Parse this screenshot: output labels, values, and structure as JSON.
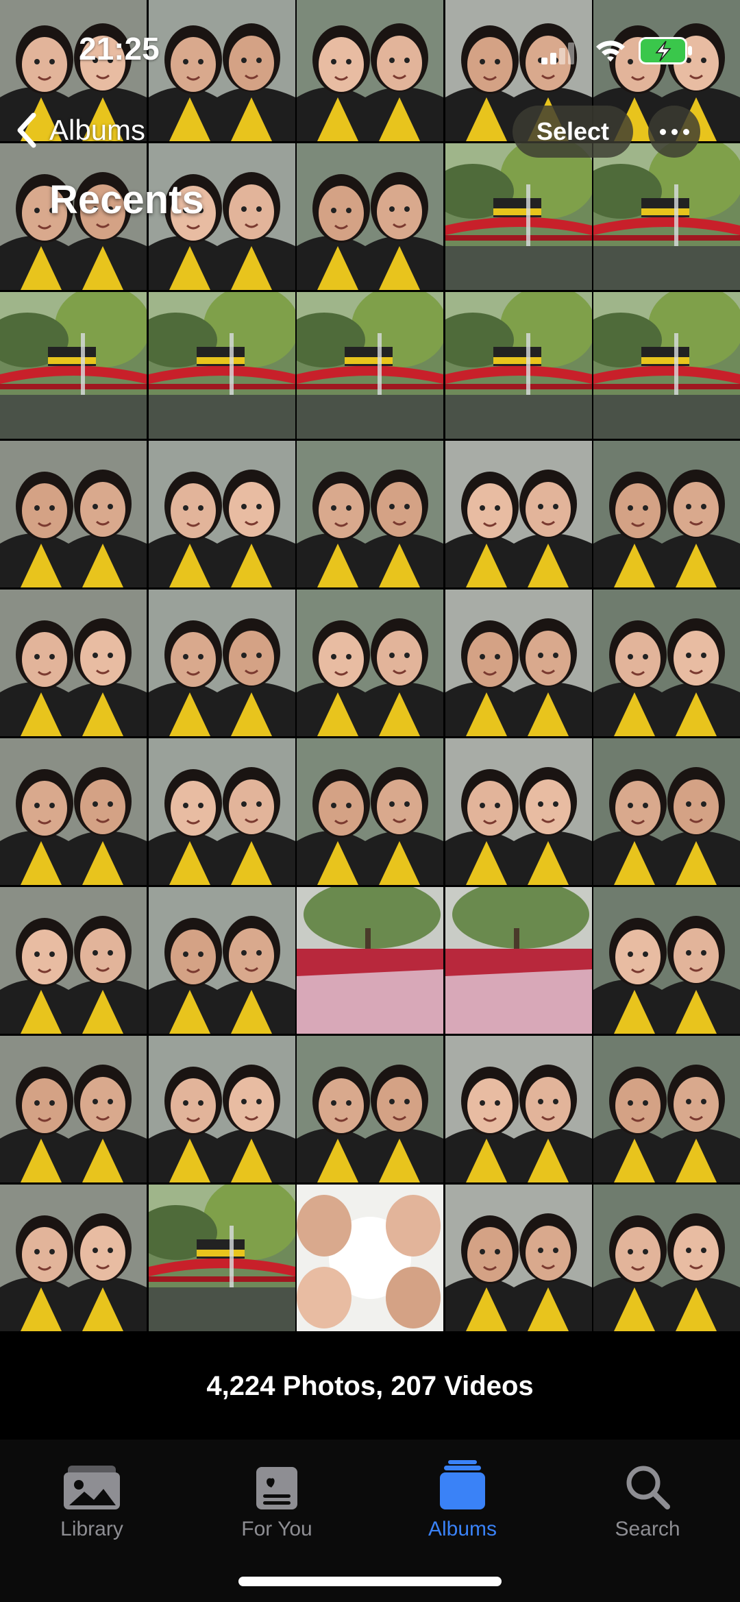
{
  "status": {
    "time": "21:25"
  },
  "nav": {
    "back_label": "Albums",
    "select_label": "Select",
    "title": "Recents"
  },
  "library": {
    "counts": "4,224 Photos, 207 Videos"
  },
  "tabs": [
    {
      "label": "Library",
      "icon": "photo-stack-icon",
      "active": false
    },
    {
      "label": "For You",
      "icon": "for-you-card-icon",
      "active": false
    },
    {
      "label": "Albums",
      "icon": "albums-folder-icon",
      "active": true
    },
    {
      "label": "Search",
      "icon": "magnifier-icon",
      "active": false
    }
  ],
  "colors": {
    "accent": "#3a82f7",
    "gown_yellow": "#e8c41d",
    "bridge_red": "#c8202a"
  }
}
